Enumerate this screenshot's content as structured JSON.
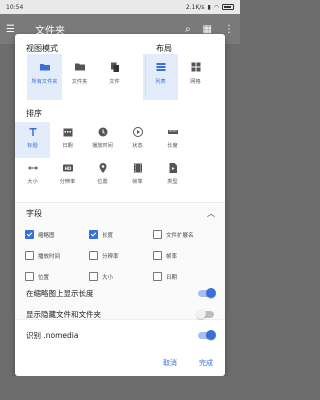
{
  "status": {
    "time": "10:54",
    "network": "2.1K/s",
    "battery": "74"
  },
  "appbar": {
    "title": "文件夹"
  },
  "dialog": {
    "view_mode_title": "视图模式",
    "layout_title": "布局",
    "view_modes": [
      {
        "label": "所有文件夹",
        "selected": true,
        "icon": "folder-open-icon"
      },
      {
        "label": "文件夹",
        "selected": false,
        "icon": "folder-icon"
      },
      {
        "label": "文件",
        "selected": false,
        "icon": "file-copy-icon"
      }
    ],
    "layouts": [
      {
        "label": "列表",
        "selected": true,
        "icon": "list-icon"
      },
      {
        "label": "网格",
        "selected": false,
        "icon": "grid-icon"
      }
    ],
    "sort_title": "排序",
    "sort_options": [
      {
        "label": "标题",
        "selected": true,
        "icon": "title-icon"
      },
      {
        "label": "日期",
        "selected": false,
        "icon": "calendar-icon"
      },
      {
        "label": "播放时间",
        "selected": false,
        "icon": "clock-icon"
      },
      {
        "label": "状态",
        "selected": false,
        "icon": "status-icon"
      },
      {
        "label": "长度",
        "selected": false,
        "icon": "ruler-icon"
      },
      {
        "label": "大小",
        "selected": false,
        "icon": "size-arrows-icon"
      },
      {
        "label": "分辨率",
        "selected": false,
        "icon": "hd-icon"
      },
      {
        "label": "位置",
        "selected": false,
        "icon": "location-icon"
      },
      {
        "label": "帧率",
        "selected": false,
        "icon": "film-icon"
      },
      {
        "label": "类型",
        "selected": false,
        "icon": "file-type-icon"
      }
    ],
    "fields_title": "字段",
    "fields": [
      {
        "label": "缩略图",
        "checked": true
      },
      {
        "label": "长度",
        "checked": true
      },
      {
        "label": "文件扩展名",
        "checked": false
      },
      {
        "label": "播放时间",
        "checked": false
      },
      {
        "label": "分辨率",
        "checked": false
      },
      {
        "label": "帧率",
        "checked": false
      },
      {
        "label": "位置",
        "checked": false
      },
      {
        "label": "大小",
        "checked": false
      },
      {
        "label": "日期",
        "checked": false
      }
    ],
    "toggles": [
      {
        "label": "在缩略图上显示长度",
        "on": true
      },
      {
        "label": "显示隐藏文件和文件夹",
        "on": false
      },
      {
        "label": "识别 .nomedia",
        "on": true
      }
    ],
    "cancel_label": "取消",
    "done_label": "完成"
  },
  "colors": {
    "accent": "#3a6fd8",
    "selected_bg": "#e3ecfb",
    "scrim": "#6d6d6d"
  }
}
